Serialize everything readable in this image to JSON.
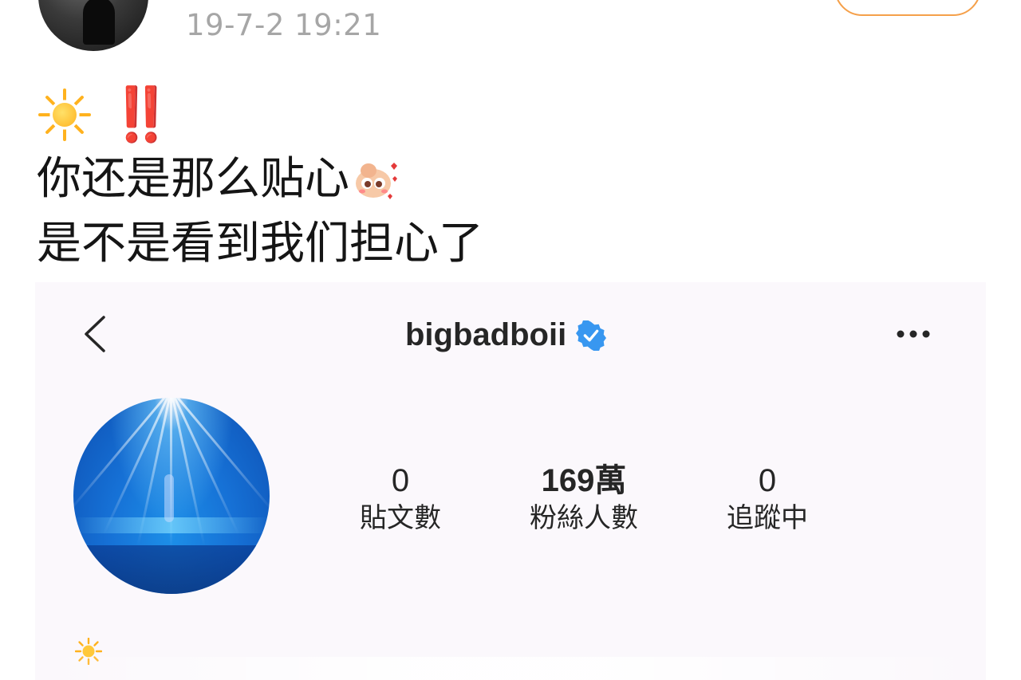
{
  "post": {
    "timestamp": "19-7-2 19:21",
    "emoji_line": {
      "sun_emoji": "sun-icon",
      "exclamation": "‼️"
    },
    "line1": "你还是那么贴心",
    "line1_sticker": "cute-sticker-icon",
    "line2": "是不是看到我们担心了"
  },
  "embedded_profile": {
    "username": "bigbadboii",
    "verified": "verified-badge-icon",
    "stats": [
      {
        "value": "0",
        "label": "貼文數"
      },
      {
        "value": "169萬",
        "label": "粉絲人數"
      },
      {
        "value": "0",
        "label": "追蹤中"
      }
    ],
    "bio_emoji": "sun-icon"
  },
  "colors": {
    "timestamp": "#a6a6a6",
    "follow_border": "#f5a04a",
    "verified": "#3897f0",
    "exclamation": "#e8231c",
    "embedded_bg": "#fbf8fc"
  }
}
